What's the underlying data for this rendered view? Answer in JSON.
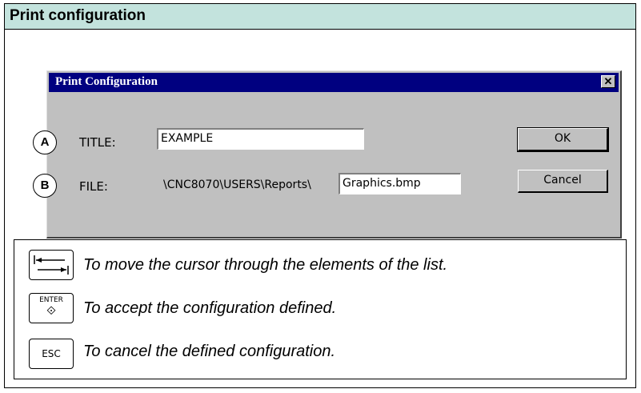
{
  "header": {
    "title": "Print configuration"
  },
  "dialog": {
    "title": "Print Configuration",
    "close_symbol": "✕",
    "rows": [
      {
        "marker": "A",
        "label": "TITLE:",
        "value": "EXAMPLE"
      },
      {
        "marker": "B",
        "label": "FILE:",
        "path_prefix": "\\CNC8070\\USERS\\Reports\\",
        "value": "Graphics.bmp"
      }
    ],
    "ok_label": "OK",
    "cancel_label": "Cancel"
  },
  "legend": {
    "items": [
      {
        "key": "tab-arrows-icon",
        "description": "To move the cursor through the elements of the list."
      },
      {
        "key": "ENTER",
        "key_symbol": "⟐",
        "description": "To accept the configuration defined."
      },
      {
        "key": "ESC",
        "description": "To cancel the defined configuration."
      }
    ]
  }
}
